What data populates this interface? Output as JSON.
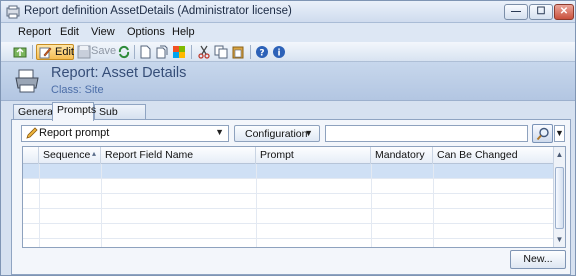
{
  "window": {
    "title": "Report definition AssetDetails (Administrator license)",
    "min_glyph": "—",
    "max_glyph": "☐",
    "close_glyph": "✕"
  },
  "menu": [
    "Report",
    "Edit",
    "View",
    "Options",
    "Help"
  ],
  "toolbar": {
    "edit_label": "Edit",
    "save_label": "Save",
    "icons": [
      "open-icon",
      "edit-icon",
      "save-icon",
      "refresh-icon",
      "new-document-icon",
      "copy-document-icon",
      "import-icon",
      "cut-icon",
      "copy-icon",
      "paste-icon",
      "help-icon",
      "info-icon"
    ]
  },
  "header": {
    "title": "Report: Asset Details",
    "class_line": "Class: Site",
    "icon": "printer-icon"
  },
  "tabs": [
    {
      "label": "General",
      "active": false
    },
    {
      "label": "Prompts",
      "active": true
    },
    {
      "label": "Sub Reports",
      "active": false
    }
  ],
  "controls": {
    "prompt_type": "Report prompt",
    "config_label": "Configuration",
    "search_value": "",
    "dropdown_glyph": "▼"
  },
  "grid": {
    "columns": [
      "",
      "Sequence",
      "Report Field Name",
      "Prompt",
      "Mandatory",
      "Can Be Changed"
    ],
    "sort_indicator": "▴",
    "rows": [
      {
        "sequence": "",
        "report_field_name": "",
        "prompt": "",
        "mandatory": "",
        "can_be_changed": "",
        "selected": true
      }
    ]
  },
  "buttons": {
    "new_label": "New..."
  },
  "colors": {
    "accent": "#4c6ea8",
    "title_text": "#364e78",
    "window_bg": "#d6e1f0",
    "selected_row": "#cfe0f5"
  }
}
